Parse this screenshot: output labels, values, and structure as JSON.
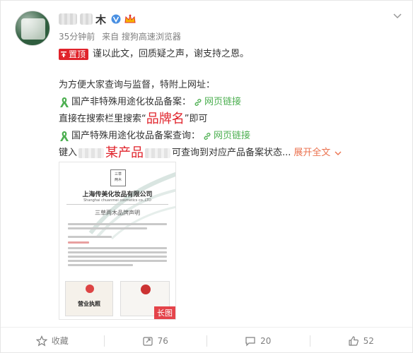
{
  "post": {
    "author_name": "木",
    "meta": {
      "time": "35分钟前",
      "source": "来自 搜狗高速浏览器"
    },
    "pin_label": "置顶",
    "line1": "谨以此文，回质疑之声，谢支持之恩。",
    "line2": "为方便大家查询与监督，特附上网址：",
    "line3_text": "国产非特殊用途化妆品备案：",
    "link_label": "网页链接",
    "line4_pre": "直接在搜索栏里搜索“",
    "line4_highlight": "品牌名",
    "line4_post": "”即可",
    "line5_text": "国产特殊用途化妆品备案查询：",
    "line6_pre": "键入",
    "line6_highlight": "某产品",
    "line6_post": "可查询到对应产品备案状态...",
    "expand_label": "展开全文",
    "image": {
      "company_cn": "上海传美化妆品有限公司",
      "company_en": "Shanghai chuanmei cosmetics co.,LTD",
      "brand_statement": "三草两木品牌声明",
      "license_title": "营业执照",
      "long_badge": "长图"
    }
  },
  "actions": {
    "favorite": "收藏",
    "repost": "76",
    "comment": "20",
    "like": "52"
  },
  "colors": {
    "accent": "#eb7350",
    "pin_red": "#e0232b",
    "link_green": "#4caf50",
    "meta_gray": "#808080"
  },
  "icons": {
    "verified": "verified-v-icon",
    "member": "crown-icon",
    "ribbon": "green-ribbon-icon",
    "link": "link-icon",
    "chevron": "chevron-down-icon",
    "favorite": "star-icon",
    "repost": "repost-icon",
    "comment": "comment-icon",
    "like": "thumb-up-icon"
  }
}
